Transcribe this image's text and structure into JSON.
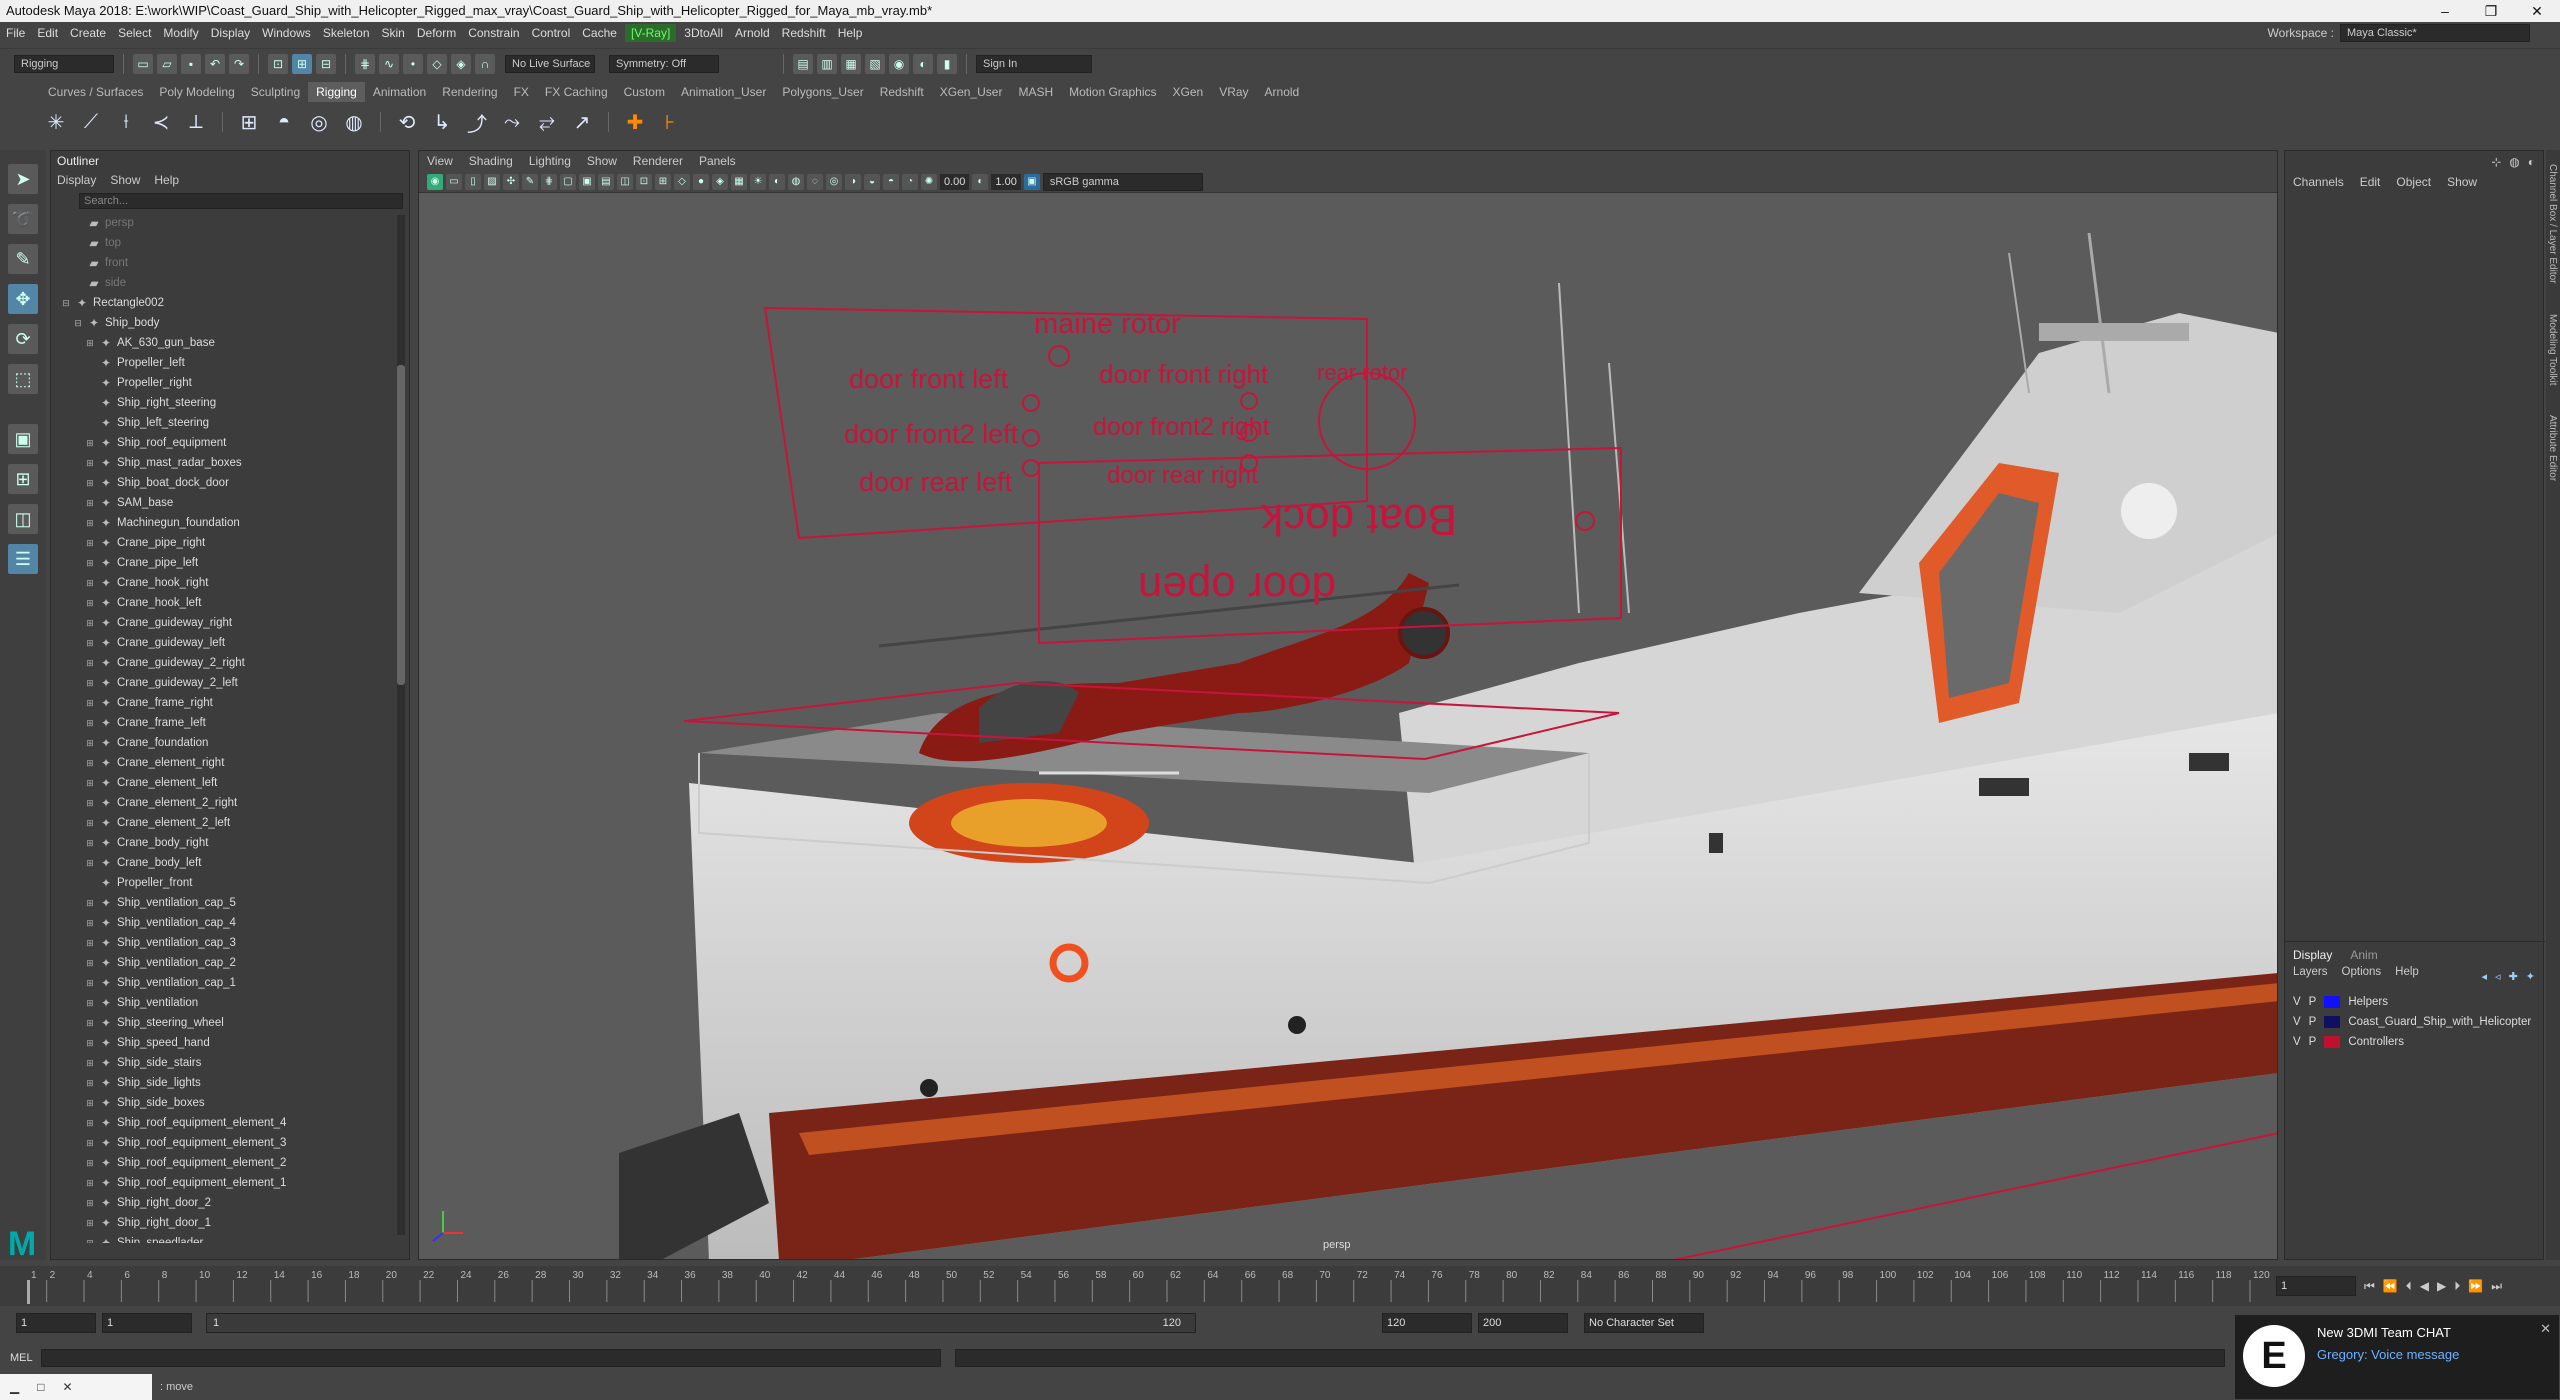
{
  "window": {
    "title": "Autodesk Maya 2018: E:\\work\\WIP\\Coast_Guard_Ship_with_Helicopter_Rigged_max_vray\\Coast_Guard_Ship_with_Helicopter_Rigged_for_Maya_mb_vray.mb*",
    "controls": [
      "–",
      "❐",
      "✕"
    ]
  },
  "menubar": {
    "items": [
      "File",
      "Edit",
      "Create",
      "Select",
      "Modify",
      "Display",
      "Windows",
      "Skeleton",
      "Skin",
      "Deform",
      "Constrain",
      "Control",
      "Cache"
    ],
    "vray": "[V-Ray]",
    "items2": [
      "3DtoAll",
      "Arnold",
      "Redshift",
      "Help"
    ],
    "workspace_label": "Workspace :",
    "workspace_value": "Maya Classic*"
  },
  "statusline": {
    "mode": "Rigging",
    "symmetry": "Symmetry: Off",
    "live_surface": "No Live Surface",
    "sign_in": "Sign In"
  },
  "shelf": {
    "tabs": [
      "Curves / Surfaces",
      "Poly Modeling",
      "Sculpting",
      "Rigging",
      "Animation",
      "Rendering",
      "FX",
      "FX Caching",
      "Custom",
      "Animation_User",
      "Polygons_User",
      "Redshift",
      "XGen_User",
      "MASH",
      "Motion Graphics",
      "XGen",
      "VRay",
      "Arnold"
    ],
    "selected": "Rigging"
  },
  "outliner": {
    "title": "Outliner",
    "menu": [
      "Display",
      "Show",
      "Help"
    ],
    "search_placeholder": "Search...",
    "cameras": [
      "persp",
      "top",
      "front",
      "side"
    ],
    "root": "Rectangle002",
    "group": "Ship_body",
    "children": [
      "AK_630_gun_base",
      "Propeller_left",
      "Propeller_right",
      "Ship_right_steering",
      "Ship_left_steering",
      "Ship_roof_equipment",
      "Ship_mast_radar_boxes",
      "Ship_boat_dock_door",
      "SAM_base",
      "Machinegun_foundation",
      "Crane_pipe_right",
      "Crane_pipe_left",
      "Crane_hook_right",
      "Crane_hook_left",
      "Crane_guideway_right",
      "Crane_guideway_left",
      "Crane_guideway_2_right",
      "Crane_guideway_2_left",
      "Crane_frame_right",
      "Crane_frame_left",
      "Crane_foundation",
      "Crane_element_right",
      "Crane_element_left",
      "Crane_element_2_right",
      "Crane_element_2_left",
      "Crane_body_right",
      "Crane_body_left",
      "Propeller_front",
      "Ship_ventilation_cap_5",
      "Ship_ventilation_cap_4",
      "Ship_ventilation_cap_3",
      "Ship_ventilation_cap_2",
      "Ship_ventilation_cap_1",
      "Ship_ventilation",
      "Ship_steering_wheel",
      "Ship_speed_hand",
      "Ship_side_stairs",
      "Ship_side_lights",
      "Ship_side_boxes",
      "Ship_roof_equipment_element_4",
      "Ship_roof_equipment_element_3",
      "Ship_roof_equipment_element_2",
      "Ship_roof_equipment_element_1",
      "Ship_right_door_2",
      "Ship_right_door_1",
      "Ship_speedlader"
    ]
  },
  "viewport": {
    "menu": [
      "View",
      "Shading",
      "Lighting",
      "Show",
      "Renderer",
      "Panels"
    ],
    "field1": "0.00",
    "field2": "1.00",
    "color_space": "sRGB gamma",
    "camera": "persp",
    "labels": {
      "main_rotor": "maine rotor",
      "rear_rotor": "rear rotor",
      "door_front_left": "door front left",
      "door_front_right": "door front right",
      "door_front2_left": "door front2 left",
      "door_front2_right": "door front2 right",
      "door_rear_left": "door rear left",
      "door_rear_right": "door rear right",
      "boat_dock": "Boat dock",
      "door_open": "door open"
    },
    "colors": {
      "controller": "#c8143c",
      "hull_red": "#7a2418",
      "hull_white": "#dcdcdc",
      "helicopter": "#8a1a14"
    }
  },
  "channelbox": {
    "menu": [
      "Channels",
      "Edit",
      "Object",
      "Show"
    ],
    "layer_tabs": [
      "Display",
      "Anim"
    ],
    "layer_menu": [
      "Layers",
      "Options",
      "Help"
    ],
    "layers": [
      {
        "v": "V",
        "p": "P",
        "name": "Helpers",
        "color": "#1010ff"
      },
      {
        "v": "V",
        "p": "P",
        "name": "Coast_Guard_Ship_with_Helicopter",
        "color": "#101060"
      },
      {
        "v": "V",
        "p": "P",
        "name": "Controllers",
        "color": "#c01030"
      }
    ]
  },
  "side_tabs": [
    "Channel Box / Layer Editor",
    "Modeling Toolkit",
    "Attribute Editor"
  ],
  "timeline": {
    "ticks": [
      "1",
      "2",
      "4",
      "6",
      "8",
      "10",
      "12",
      "14",
      "16",
      "18",
      "20",
      "22",
      "24",
      "26",
      "28",
      "30",
      "32",
      "34",
      "36",
      "38",
      "40",
      "42",
      "44",
      "46",
      "48",
      "50",
      "52",
      "54",
      "56",
      "58",
      "60",
      "62",
      "64",
      "66",
      "68",
      "70",
      "72",
      "74",
      "76",
      "78",
      "80",
      "82",
      "84",
      "86",
      "88",
      "90",
      "92",
      "94",
      "96",
      "98",
      "100",
      "102",
      "104",
      "106",
      "108",
      "110",
      "112",
      "114",
      "116",
      "118",
      "120"
    ],
    "current_frame": "1"
  },
  "range": {
    "start": "1",
    "start2": "1",
    "range_start": "1",
    "range_end": "120",
    "end": "120",
    "end2": "200",
    "character_set": "No Character Set"
  },
  "cmdline": {
    "label": "MEL"
  },
  "helpline": {
    "text": ": move"
  },
  "notification": {
    "title": "New 3DMI Team CHAT",
    "subtitle": "Gregory: Voice message",
    "logo": "E"
  }
}
